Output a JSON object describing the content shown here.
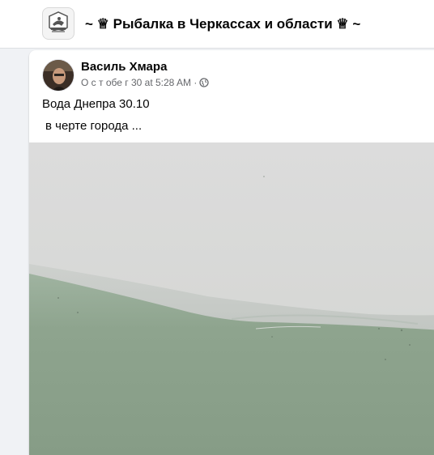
{
  "group": {
    "title": "~ ♕ Рыбалка в Черкассах и области ♕ ~",
    "logo_icon": "group-logo-icon"
  },
  "post": {
    "author": "Василь Хмара",
    "timestamp": "О с т обе г 30 at 5:28 AM ·",
    "privacy_icon": "globe-icon",
    "text_line1": "Вода Днепра 30.10",
    "text_line2": "в черте города ...",
    "photo_icon": "photo-river-fog"
  },
  "colors": {
    "page_bg": "#f0f2f5",
    "card_bg": "#ffffff",
    "meta_text": "#65676b",
    "water": "#8fa48f",
    "fog": "#d8dad8"
  }
}
